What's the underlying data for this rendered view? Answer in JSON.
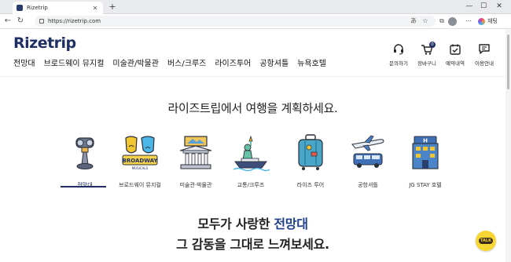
{
  "browser": {
    "tab_title": "Rizetrip",
    "tab_close": "✕",
    "new_tab": "+",
    "url": "https://rizetrip.com",
    "profile_label": "채팅",
    "window_controls": [
      "—",
      "☐",
      "✕"
    ]
  },
  "site": {
    "logo": "Rizetrip",
    "nav": [
      "전망대",
      "브로드웨이 뮤지컬",
      "미술관/박물관",
      "버스/크루즈",
      "라이즈투어",
      "공항셔틀",
      "뉴욕호텔"
    ],
    "quick_links": [
      {
        "label": "문의하기",
        "icon": "headset-icon"
      },
      {
        "label": "장바구니",
        "icon": "cart-icon",
        "badge": "0"
      },
      {
        "label": "예약내역",
        "icon": "calendar-check-icon"
      },
      {
        "label": "이용안내",
        "icon": "chat-icon"
      }
    ],
    "brand_color": "#1f2f63"
  },
  "main": {
    "headline": "라이즈트립에서 여행을 계획하세요.",
    "categories": [
      {
        "label": "전망대",
        "icon": "binoculars-icon",
        "active": true
      },
      {
        "label": "브로드웨이 뮤지컬",
        "icon": "broadway-masks-icon",
        "illustration_text": "BROADWAY",
        "illustration_subtext": "MUSICALS",
        "active": false
      },
      {
        "label": "미술관·박물관",
        "icon": "museum-icon",
        "active": false
      },
      {
        "label": "교통/크루즈",
        "icon": "statue-of-liberty-icon",
        "active": false
      },
      {
        "label": "라이즈 투어",
        "icon": "suitcase-icon",
        "active": false
      },
      {
        "label": "공항셔틀",
        "icon": "airplane-shuttle-icon",
        "active": false
      },
      {
        "label": "JG STAY 호텔",
        "icon": "hotel-icon",
        "illustration_text": "H",
        "active": false
      }
    ],
    "promo_line1_prefix": "모두가 사랑한 ",
    "promo_line1_highlight": "전망대",
    "promo_line2": "그 감동을 그대로 느껴보세요.",
    "talk_button": "TALK"
  }
}
